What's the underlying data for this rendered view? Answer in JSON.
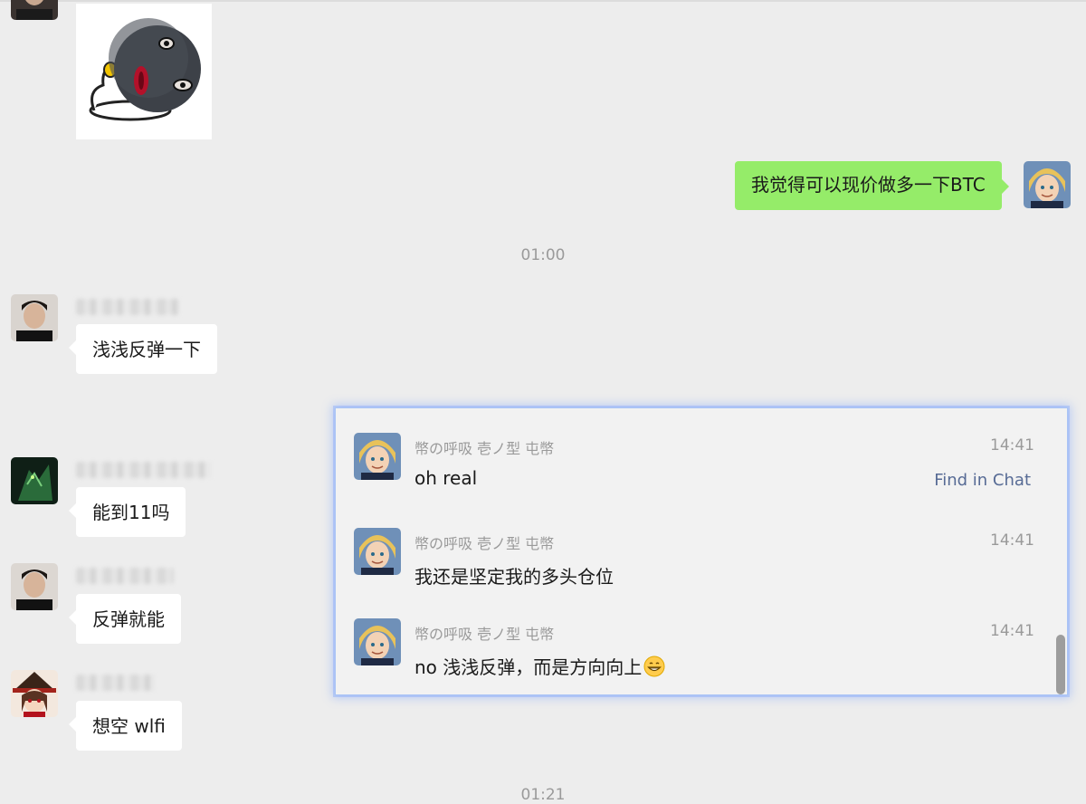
{
  "chat": {
    "my_message": "我觉得可以现价做多一下BTC",
    "timestamp_1": "01:00",
    "timestamp_2": "01:21",
    "messages": [
      {
        "text": "浅浅反弹一下"
      },
      {
        "text": "能到11吗"
      },
      {
        "text": "反弹就能"
      },
      {
        "text": "想空 wlfi"
      }
    ]
  },
  "search_results": {
    "find_label": "Find in Chat",
    "items": [
      {
        "sender": "幣の呼吸 壱ノ型 屯幣",
        "time": "14:41",
        "text": "oh real"
      },
      {
        "sender": "幣の呼吸 壱ノ型 屯幣",
        "time": "14:41",
        "text": "我还是坚定我的多头仓位"
      },
      {
        "sender": "幣の呼吸 壱ノ型 屯幣",
        "time": "14:41",
        "text": "no 浅浅反弹，而是方向向上"
      }
    ]
  },
  "icons": {
    "sticker": "ball-head-sticker",
    "emoji": "grinning-face-emoji",
    "avatars": [
      "anime-boy-avatar",
      "person-photo-avatar",
      "green-character-avatar",
      "anime-witch-avatar"
    ]
  },
  "colors": {
    "my_bubble": "#95ec69",
    "link": "#576b95",
    "highlight_border": "#a9c4f5"
  }
}
